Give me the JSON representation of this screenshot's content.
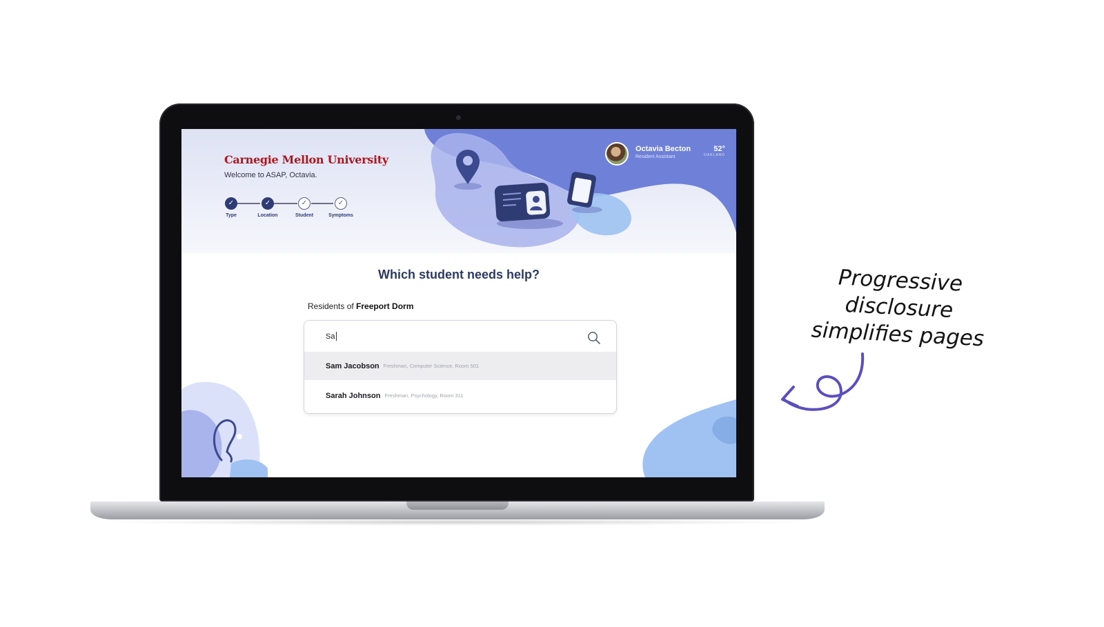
{
  "app": {
    "logo_text": "Carnegie Mellon University",
    "welcome": "Welcome to ASAP, Octavia."
  },
  "stepper": {
    "steps": [
      {
        "label": "Type",
        "status": "done"
      },
      {
        "label": "Location",
        "status": "done"
      },
      {
        "label": "Student",
        "status": "todo"
      },
      {
        "label": "Symptoms",
        "status": "todo"
      }
    ]
  },
  "user": {
    "name": "Octavia Becton",
    "role": "Resident Assistant"
  },
  "weather": {
    "temp": "52°",
    "city": "OAKLAND"
  },
  "main": {
    "question": "Which student needs help?",
    "residents_prefix": "Residents of",
    "dorm": "Freeport Dorm"
  },
  "search": {
    "value": "Sa"
  },
  "results": [
    {
      "name": "Sam Jacobson",
      "detail": "Freshman, Computer Science, Room 501"
    },
    {
      "name": "Sarah Johnson",
      "detail": "Freshman, Psychology, Room 311"
    }
  ],
  "annotation": {
    "line1": "Progressive disclosure",
    "line2": "simplifies pages"
  },
  "colors": {
    "brand_red": "#b1151c",
    "navy": "#2f3c74",
    "blob_blue": "#6f80d9",
    "annotation_arrow": "#5b4fbf"
  },
  "icons": [
    "search-icon",
    "location-pin-icon",
    "id-card-icon",
    "clipboard-icon",
    "stethoscope-icon",
    "checkmark-icon",
    "curly-arrow-icon"
  ]
}
